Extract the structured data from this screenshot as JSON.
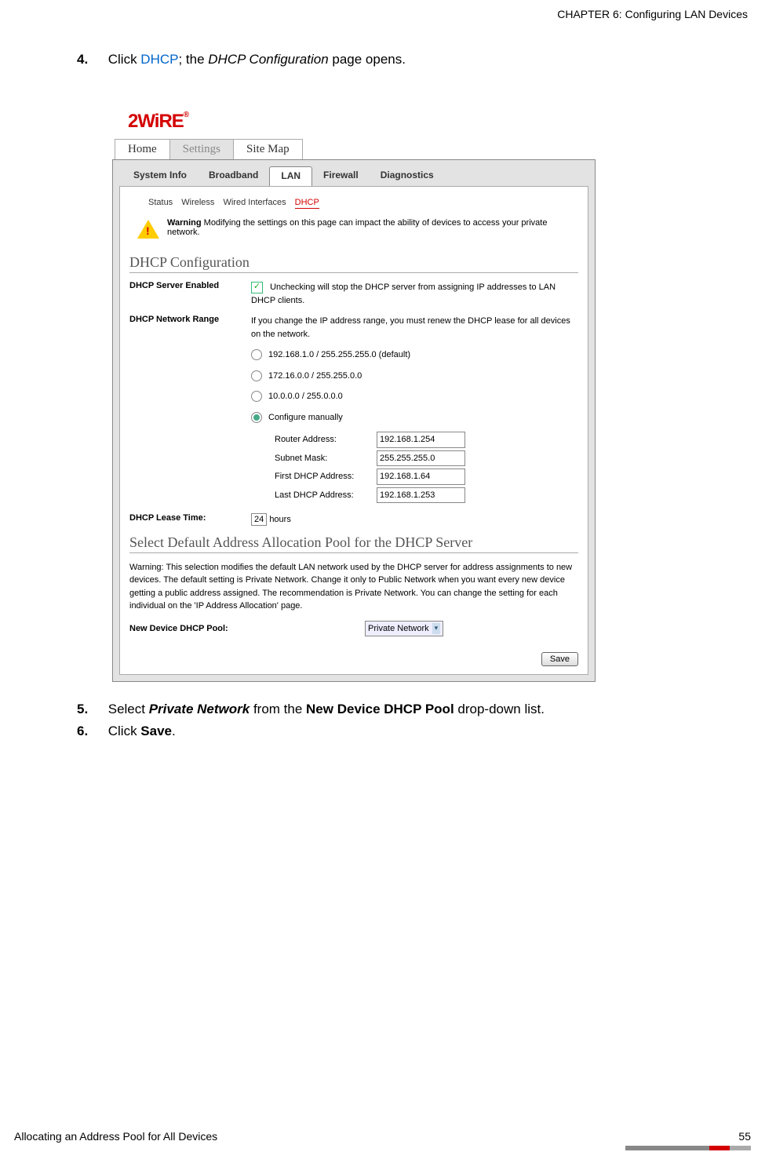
{
  "header": {
    "chapter": "CHAPTER 6: Configuring LAN Devices"
  },
  "steps": {
    "s4": {
      "num": "4.",
      "prefix": "Click ",
      "link": "DHCP",
      "mid": "; the ",
      "italic": "DHCP Configuration",
      "suffix": " page opens."
    },
    "s5": {
      "num": "5.",
      "prefix": "Select ",
      "bold_italic": "Private Network",
      "mid": " from the ",
      "bold": "New Device DHCP Pool",
      "suffix": " drop-down list."
    },
    "s6": {
      "num": "6.",
      "prefix": "Click ",
      "bold": "Save",
      "suffix": "."
    }
  },
  "ui": {
    "logo": "2WiRE",
    "logo_mark": "®",
    "top_tabs": {
      "home": "Home",
      "settings": "Settings",
      "sitemap": "Site Map"
    },
    "sub_tabs": {
      "sys": "System Info",
      "bb": "Broadband",
      "lan": "LAN",
      "fw": "Firewall",
      "diag": "Diagnostics"
    },
    "subsub": {
      "status": "Status",
      "wireless": "Wireless",
      "wired": "Wired Interfaces",
      "dhcp": "DHCP"
    },
    "warning": {
      "label": "Warning",
      "text": " Modifying the settings on this page can impact the ability of devices to access your private network."
    },
    "section1": "DHCP Configuration",
    "dhcp_enabled": {
      "label": "DHCP Server Enabled",
      "desc": "Unchecking will stop the DHCP server from assigning IP addresses to LAN DHCP clients."
    },
    "network_range": {
      "label": "DHCP Network Range",
      "desc": "If you change the IP address range, you must renew the DHCP lease for all devices on the network.",
      "opt1": "192.168.1.0 / 255.255.255.0 (default)",
      "opt2": "172.16.0.0 / 255.255.0.0",
      "opt3": "10.0.0.0 / 255.0.0.0",
      "opt4": "Configure manually",
      "router_label": "Router Address:",
      "router_val": "192.168.1.254",
      "subnet_label": "Subnet Mask:",
      "subnet_val": "255.255.255.0",
      "first_label": "First DHCP Address:",
      "first_val": "192.168.1.64",
      "last_label": "Last DHCP Address:",
      "last_val": "192.168.1.253"
    },
    "lease": {
      "label": "DHCP Lease Time:",
      "value": "24",
      "unit": "hours"
    },
    "section2": "Select Default Address Allocation Pool for the DHCP Server",
    "pool_warning": "Warning: This selection modifies the default LAN network used by the DHCP server for address assignments to new devices. The default setting is Private Network. Change it only to Public Network when you want every new device getting a public address assigned. The recommendation is Private Network. You can change the setting for each individual on the 'IP Address Allocation' page.",
    "pool_label": "New Device DHCP Pool:",
    "pool_value": "Private Network",
    "save": "Save"
  },
  "footer": {
    "left": "Allocating an Address Pool for All Devices",
    "right": "55"
  }
}
